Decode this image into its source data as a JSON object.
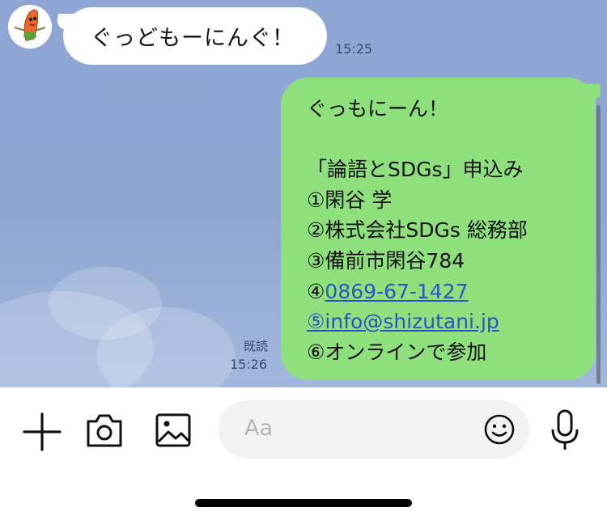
{
  "incoming_message": {
    "text": "ぐっどもーにんぐ！",
    "time": "15:25"
  },
  "outgoing_message": {
    "lines": [
      "ぐっもにーん！",
      "",
      "「論語とSDGs」申込み",
      "①閑谷 学",
      "②株式会社SDGs 総務部",
      "③備前市閑谷784",
      "④",
      "⑤",
      "⑥オンラインで参加"
    ],
    "phone_link": "0869-67-1427",
    "email_link": "info@shizutani.jp",
    "read_label": "既読",
    "time": "15:26"
  },
  "input_bar": {
    "placeholder": "Aa",
    "icons": [
      "plus-icon",
      "camera-icon",
      "image-icon",
      "emoji-icon",
      "microphone-icon"
    ]
  },
  "colors": {
    "chat_background": "#8fa6d4",
    "outgoing_bubble": "#8ee07c",
    "incoming_bubble": "#ffffff",
    "link": "#2a56c6"
  }
}
